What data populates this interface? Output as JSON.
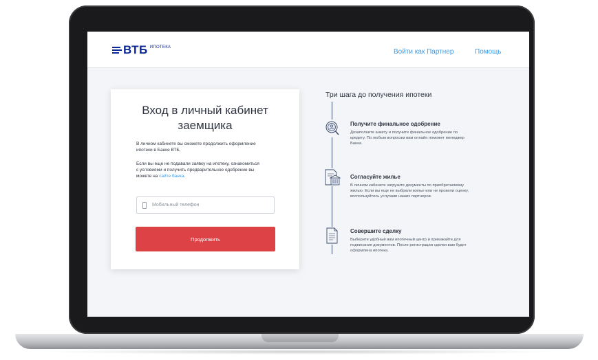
{
  "header": {
    "logo_text": "ВТБ",
    "logo_sub": "ИПОТЕКА",
    "nav": [
      {
        "label": "Войти как Партнер"
      },
      {
        "label": "Помощь"
      }
    ]
  },
  "login": {
    "title_line1": "Вход в личный кабинет",
    "title_line2": "заемщика",
    "intro_line1": "В личном кабинете вы сможете продолжить оформление",
    "intro_line2": "ипотеки в Банке ВТБ.",
    "info_line1": "Если вы еще не подавали заявку на ипотеку, ознакомиться",
    "info_line2": "с условиями и получить предварительное одобрение вы",
    "info_line3_prefix": "можете на ",
    "info_link": "сайте банка",
    "info_line3_suffix": ".",
    "phone_placeholder": "Мобильный телефон",
    "continue_label": "Продолжить"
  },
  "steps": {
    "title": "Три шага до получения ипотеки",
    "items": [
      {
        "icon": "approval-search-icon",
        "title": "Получите финальное одобрение",
        "desc_lines": [
          "Дозаполните анкету и получите финальное одобрение по",
          "кредиту. По любым вопросам вам онлайн поможет менеджер",
          "Банка."
        ]
      },
      {
        "icon": "document-bank-icon",
        "title": "Согласуйте жилье",
        "desc_lines": [
          "В личном кабинете загрузите документы по приобретаемому",
          "жилью. Если вы еще не выбрали жилье или не провели оценку,",
          "воспользуйтесь услугами наших партнеров."
        ]
      },
      {
        "icon": "document-icon",
        "title": "Совершите сделку",
        "desc_lines": [
          "Выберите удобный вам ипотечный центр и приезжайте для",
          "подписания документов. После регистрации сделки вам будет",
          "оформлена ипотека."
        ]
      }
    ]
  },
  "colors": {
    "brand_blue": "#0a2896",
    "link_blue": "#3d9be9",
    "button_red": "#dd4346",
    "page_bg": "#f3f5f8"
  }
}
